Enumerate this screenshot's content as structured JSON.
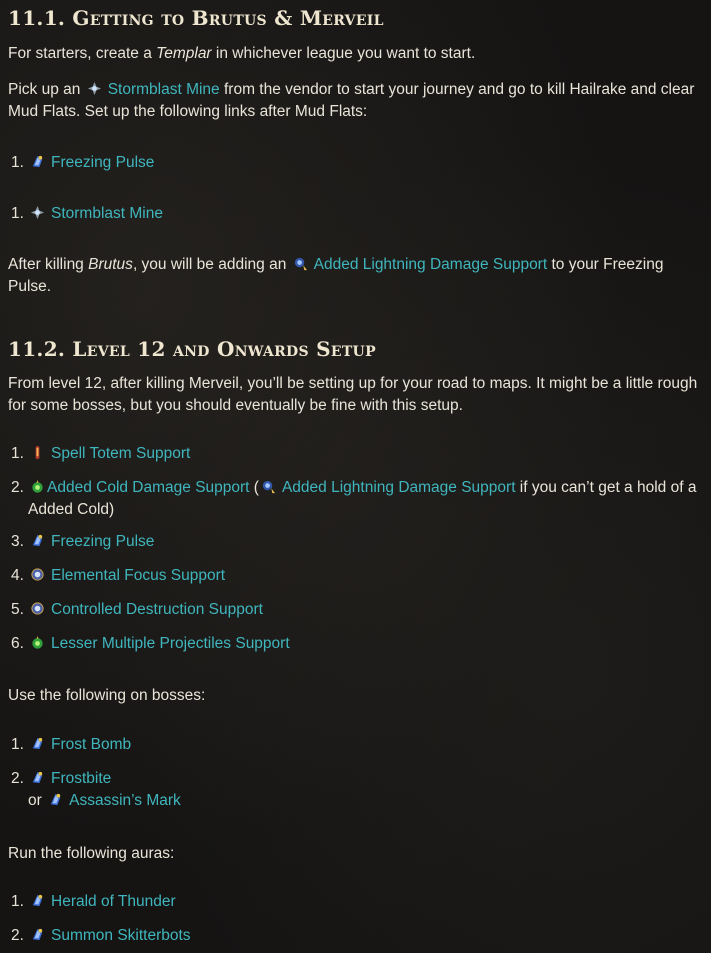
{
  "sec1": {
    "title": "11.1. Getting to Brutus & Merveil",
    "p1_pre": "For starters, create a ",
    "p1_em": "Templar",
    "p1_post": " in whichever league you want to start.",
    "p2_pre": "Pick up an ",
    "p2_link": "Stormblast Mine",
    "p2_post": " from the vendor to start your journey and go to kill Hailrake and clear Mud Flats. Set up the following links after Mud Flats:",
    "list_a": [
      {
        "num": "1.",
        "label": "Freezing Pulse",
        "icon": "freezing-pulse-icon"
      }
    ],
    "list_b": [
      {
        "num": "1.",
        "label": "Stormblast Mine",
        "icon": "stormblast-mine-icon"
      }
    ],
    "p3_pre": "After killing ",
    "p3_em": "Brutus",
    "p3_mid": ", you will be adding an ",
    "p3_link": "Added Lightning Damage Support",
    "p3_post": " to your Freezing Pulse."
  },
  "sec2": {
    "title": "11.2. Level 12 and Onwards Setup",
    "p1": "From level 12, after killing Merveil, you’ll be setting up for your road to maps. It might be a little rough for some bosses, but you should eventually be fine with this setup.",
    "list": [
      {
        "num": "1.",
        "label": "Spell Totem Support",
        "icon": "spell-totem-icon"
      },
      {
        "num": "2.",
        "label": "Added Cold Damage Support",
        "icon": "added-cold-icon",
        "open": " (",
        "alt": "Added Lightning Damage Support",
        "alt_icon": "added-lightning-icon",
        "note": " if you can’t get a hold of a Added Cold)"
      },
      {
        "num": "3.",
        "label": "Freezing Pulse",
        "icon": "freezing-pulse-icon"
      },
      {
        "num": "4.",
        "label": "Elemental Focus Support",
        "icon": "elemental-focus-icon"
      },
      {
        "num": "5.",
        "label": "Controlled Destruction Support",
        "icon": "controlled-destruction-icon"
      },
      {
        "num": "6.",
        "label": "Lesser Multiple Projectiles Support",
        "icon": "lmp-icon"
      }
    ],
    "bosses_intro": "Use the following on bosses:",
    "bosses": [
      {
        "num": "1.",
        "label": "Frost Bomb",
        "icon": "frost-bomb-icon"
      },
      {
        "num": "2.",
        "label": "Frostbite",
        "icon": "frostbite-icon",
        "or": "or",
        "alt": "Assassin’s Mark",
        "alt_icon": "assassins-mark-icon"
      }
    ],
    "auras_intro": "Run the following auras:",
    "auras": [
      {
        "num": "1.",
        "label": "Herald of Thunder",
        "icon": "herald-of-thunder-icon"
      },
      {
        "num": "2.",
        "label": "Summon Skitterbots",
        "icon": "summon-skitterbots-icon"
      }
    ]
  },
  "colors": {
    "link": "#3fb6bd",
    "text": "#e9e4d8",
    "heading": "#efe6cf",
    "background": "#151413"
  }
}
